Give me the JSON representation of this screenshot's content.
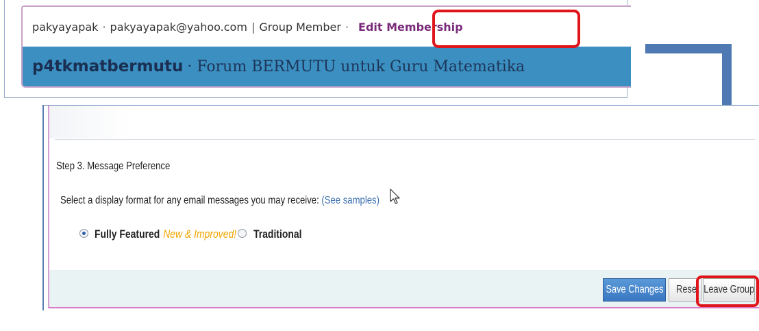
{
  "header": {
    "username": "pakyayapak",
    "email": "pakyayapak@yahoo.com",
    "role": "Group Member",
    "edit_membership_label": "Edit Membership",
    "group_name": "p4tkmatbermutu",
    "group_description": "Forum BERMUTU untuk Guru Matematika"
  },
  "form": {
    "step_title": "Step 3. Message Preference",
    "select_text": "Select a display format for any email messages you may receive:",
    "see_samples_label": "See samples",
    "options": [
      {
        "label": "Fully Featured",
        "badge": "New & Improved!",
        "selected": true
      },
      {
        "label": "Traditional",
        "selected": false
      }
    ]
  },
  "buttons": {
    "save_label": "Save Changes",
    "reset_label": "Reset",
    "leave_group_label": "Leave Group"
  },
  "colors": {
    "header_blue": "#3b8fc1",
    "highlight_red": "#e0141b",
    "arrow_blue": "#4f79b3",
    "badge_orange": "#f0a500",
    "link_blue": "#3b6fb0"
  },
  "icons": {
    "cursor": "mouse-pointer-icon",
    "arrow": "connector-arrow-icon"
  }
}
